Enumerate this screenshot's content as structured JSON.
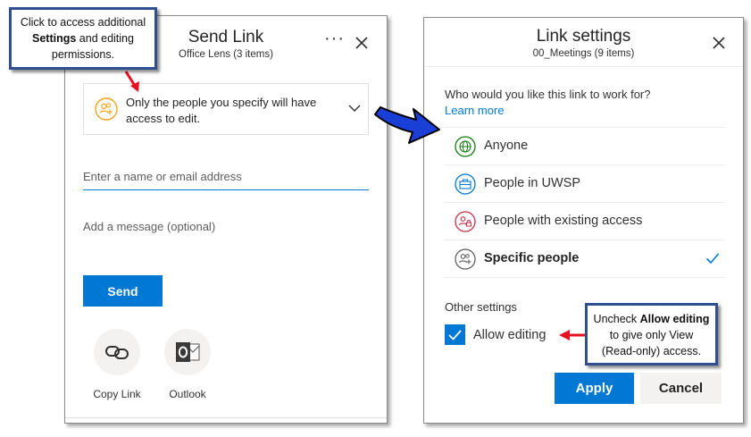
{
  "send_link": {
    "title": "Send Link",
    "subtitle": "Office Lens (3 items)",
    "more_label": "···",
    "permission_text": "Only the people you specify will have access to edit.",
    "name_placeholder": "Enter a name or email address",
    "message_placeholder": "Add a message (optional)",
    "send_label": "Send",
    "share_options": [
      {
        "label": "Copy Link",
        "icon": "link-icon"
      },
      {
        "label": "Outlook",
        "icon": "outlook-icon"
      }
    ]
  },
  "link_settings": {
    "title": "Link settings",
    "subtitle": "00_Meetings (9 items)",
    "question": "Who would you like this link to work for?",
    "learn_more": "Learn more",
    "options": [
      {
        "label": "Anyone",
        "icon": "globe-icon",
        "color": "#107c10",
        "selected": false
      },
      {
        "label": "People in UWSP",
        "icon": "building-icon",
        "color": "#0078d4",
        "selected": false
      },
      {
        "label": "People with existing access",
        "icon": "people-lock-icon",
        "color": "#c4314b",
        "selected": false
      },
      {
        "label": "Specific people",
        "icon": "people-add-icon",
        "color": "#605e5c",
        "selected": true
      }
    ],
    "other_settings": "Other settings",
    "allow_editing_label": "Allow editing",
    "allow_editing_checked": true,
    "apply_label": "Apply",
    "cancel_label": "Cancel"
  },
  "callouts": {
    "settings": {
      "line1": "Click to access additional",
      "bold": "Settings",
      "rest": " and editing",
      "line3": "permissions."
    },
    "editing": {
      "pre": "Uncheck ",
      "bold": "Allow editing",
      "line2": "to give only View",
      "line3": "(Read-only) access."
    }
  },
  "colors": {
    "accent": "#0078d4",
    "arrow_red": "#e81123",
    "arrow_blue": "#1a3fd6",
    "callout_border": "#2f4f8f",
    "permission_orange": "#f7a21b"
  }
}
